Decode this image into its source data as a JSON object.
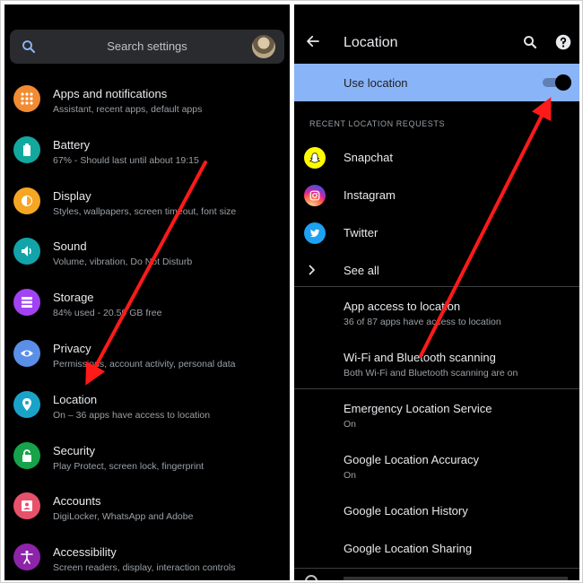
{
  "left": {
    "search": {
      "placeholder": "Search settings"
    },
    "settings": [
      {
        "title": "Apps and notifications",
        "subtitle": "Assistant, recent apps, default apps",
        "icon": "apps-icon",
        "color": "#f28b31"
      },
      {
        "title": "Battery",
        "subtitle": "67% - Should last until about 19:15",
        "icon": "battery-icon",
        "color": "#13a89e"
      },
      {
        "title": "Display",
        "subtitle": "Styles, wallpapers, screen timeout, font size",
        "icon": "brightness-icon",
        "color": "#f5a623"
      },
      {
        "title": "Sound",
        "subtitle": "Volume, vibration, Do Not Disturb",
        "icon": "volume-icon",
        "color": "#12a4a8"
      },
      {
        "title": "Storage",
        "subtitle": "84% used - 20.59 GB free",
        "icon": "storage-icon",
        "color": "#a142f4"
      },
      {
        "title": "Privacy",
        "subtitle": "Permissions, account activity, personal data",
        "icon": "privacy-eye-icon",
        "color": "#5a8fe8"
      },
      {
        "title": "Location",
        "subtitle": "On – 36 apps have access to location",
        "icon": "location-pin-icon",
        "color": "#1aa3c9"
      },
      {
        "title": "Security",
        "subtitle": "Play Protect, screen lock, fingerprint",
        "icon": "lock-icon",
        "color": "#16a34a"
      },
      {
        "title": "Accounts",
        "subtitle": "DigiLocker, WhatsApp and Adobe",
        "icon": "account-icon",
        "color": "#e8516b"
      },
      {
        "title": "Accessibility",
        "subtitle": "Screen readers, display, interaction controls",
        "icon": "accessibility-icon",
        "color": "#8e24aa"
      }
    ]
  },
  "right": {
    "title": "Location",
    "use_location_label": "Use location",
    "use_location_on": true,
    "recent_header": "RECENT LOCATION REQUESTS",
    "recent_apps": [
      {
        "label": "Snapchat",
        "icon": "snapchat-icon",
        "color": "#fffc00"
      },
      {
        "label": "Instagram",
        "icon": "instagram-icon",
        "color": "#d6249f"
      },
      {
        "label": "Twitter",
        "icon": "twitter-icon",
        "color": "#1da1f2"
      }
    ],
    "see_all_label": "See all",
    "items": [
      {
        "title": "App access to location",
        "subtitle": "36 of 87 apps have access to location"
      },
      {
        "title": "Wi-Fi and Bluetooth scanning",
        "subtitle": "Both Wi-Fi and Bluetooth scanning are on"
      },
      {
        "title": "Emergency Location Service",
        "subtitle": "On"
      },
      {
        "title": "Google Location Accuracy",
        "subtitle": "On"
      },
      {
        "title": "Google Location History",
        "subtitle": ""
      },
      {
        "title": "Google Location Sharing",
        "subtitle": ""
      }
    ]
  },
  "colors": {
    "panel_bg": "#000000",
    "accent": "#8ab4f8",
    "arrow": "#ff1a1a"
  }
}
